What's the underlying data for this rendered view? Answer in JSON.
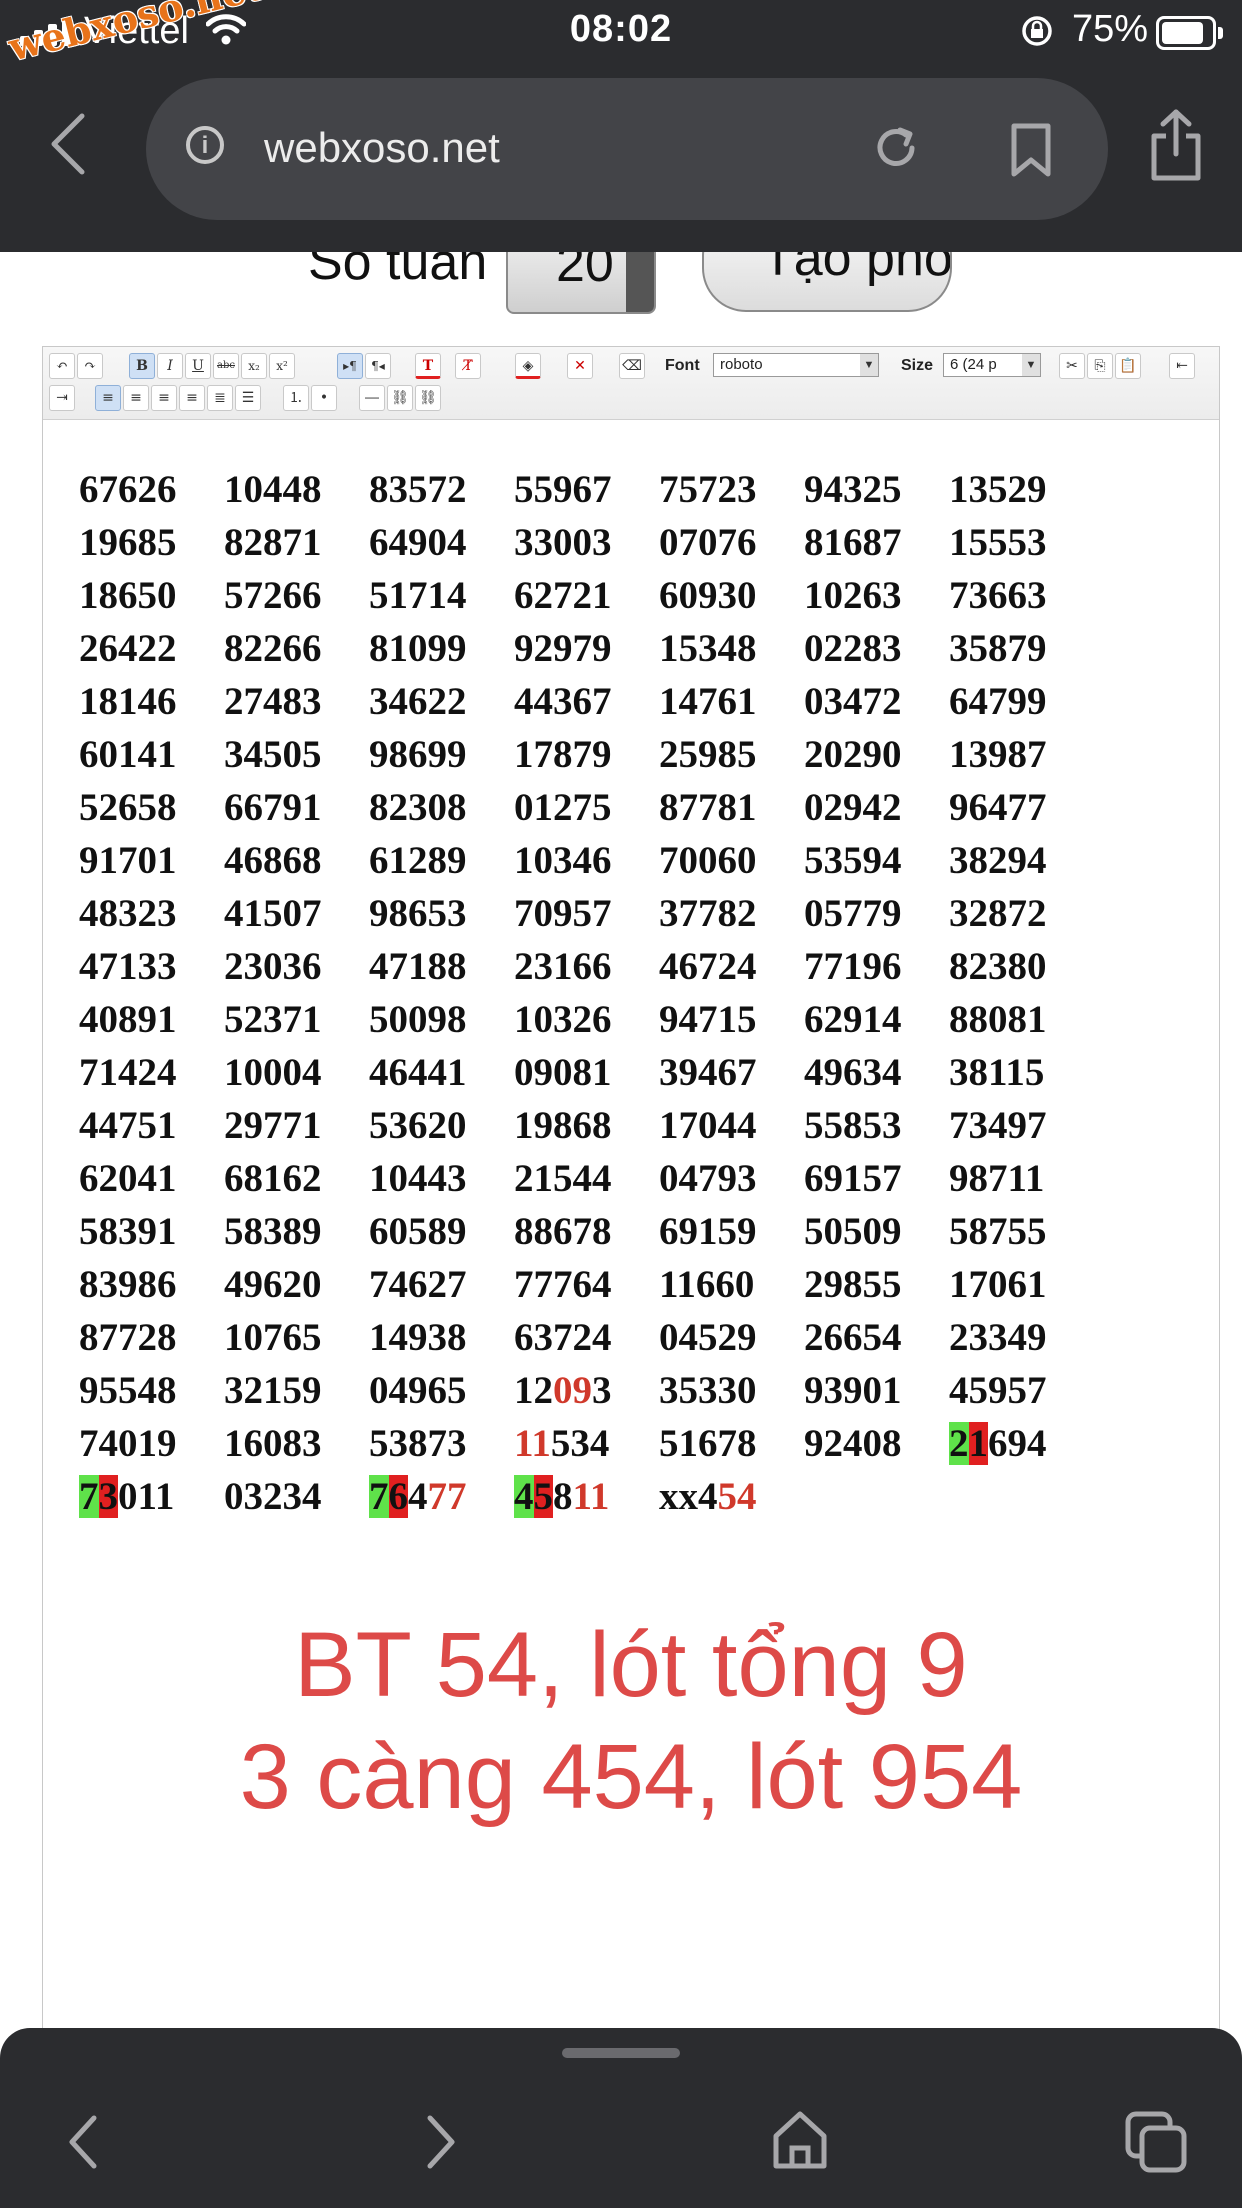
{
  "status_bar": {
    "carrier": "Viettel",
    "time": "08:02",
    "battery": "75%"
  },
  "watermark": "webxoso.net",
  "browser": {
    "url": "webxoso.net"
  },
  "controls": {
    "week_label": "Số tuần",
    "week_value": "20",
    "create_button": "Tạo phổ"
  },
  "editor_toolbar": {
    "font_label": "Font",
    "font_value": "roboto",
    "size_label": "Size",
    "size_value": "6 (24 p"
  },
  "numbers": [
    [
      "67626",
      "10448",
      "83572",
      "55967",
      "75723",
      "94325",
      "13529"
    ],
    [
      "19685",
      "82871",
      "64904",
      "33003",
      "07076",
      "81687",
      "15553"
    ],
    [
      "18650",
      "57266",
      "51714",
      "62721",
      "60930",
      "10263",
      "73663"
    ],
    [
      "26422",
      "82266",
      "81099",
      "92979",
      "15348",
      "02283",
      "35879"
    ],
    [
      "18146",
      "27483",
      "34622",
      "44367",
      "14761",
      "03472",
      "64799"
    ],
    [
      "60141",
      "34505",
      "98699",
      "17879",
      "25985",
      "20290",
      "13987"
    ],
    [
      "52658",
      "66791",
      "82308",
      "01275",
      "87781",
      "02942",
      "96477"
    ],
    [
      "91701",
      "46868",
      "61289",
      "10346",
      "70060",
      "53594",
      "38294"
    ],
    [
      "48323",
      "41507",
      "98653",
      "70957",
      "37782",
      "05779",
      "32872"
    ],
    [
      "47133",
      "23036",
      "47188",
      "23166",
      "46724",
      "77196",
      "82380"
    ],
    [
      "40891",
      "52371",
      "50098",
      "10326",
      "94715",
      "62914",
      "88081"
    ],
    [
      "71424",
      "10004",
      "46441",
      "09081",
      "39467",
      "49634",
      "38115"
    ],
    [
      "44751",
      "29771",
      "53620",
      "19868",
      "17044",
      "55853",
      "73497"
    ],
    [
      "62041",
      "68162",
      "10443",
      "21544",
      "04793",
      "69157",
      "98711"
    ],
    [
      "58391",
      "58389",
      "60589",
      "88678",
      "69159",
      "50509",
      "58755"
    ],
    [
      "83986",
      "49620",
      "74627",
      "77764",
      "11660",
      "29855",
      "17061"
    ],
    [
      "87728",
      "10765",
      "14938",
      "63724",
      "04529",
      "26654",
      "23349"
    ],
    [
      "95548",
      "32159",
      "04965",
      "12093",
      "35330",
      "93901",
      "45957"
    ],
    [
      "74019",
      "16083",
      "53873",
      "11534",
      "51678",
      "92408",
      "21694"
    ],
    [
      "73011",
      "03234",
      "76477",
      "45811",
      "xx454"
    ]
  ],
  "colors": {
    "red_digit": "#d0392b",
    "green_highlight": "#5fe24a",
    "red_highlight": "#e02020",
    "note": "#dd4a48"
  },
  "note": {
    "line1": "BT 54, lót tổng 9",
    "line2": "3 càng 454, lót 954"
  },
  "bottom_nav": [
    "back-icon",
    "forward-icon",
    "home-icon",
    "tabs-icon"
  ]
}
